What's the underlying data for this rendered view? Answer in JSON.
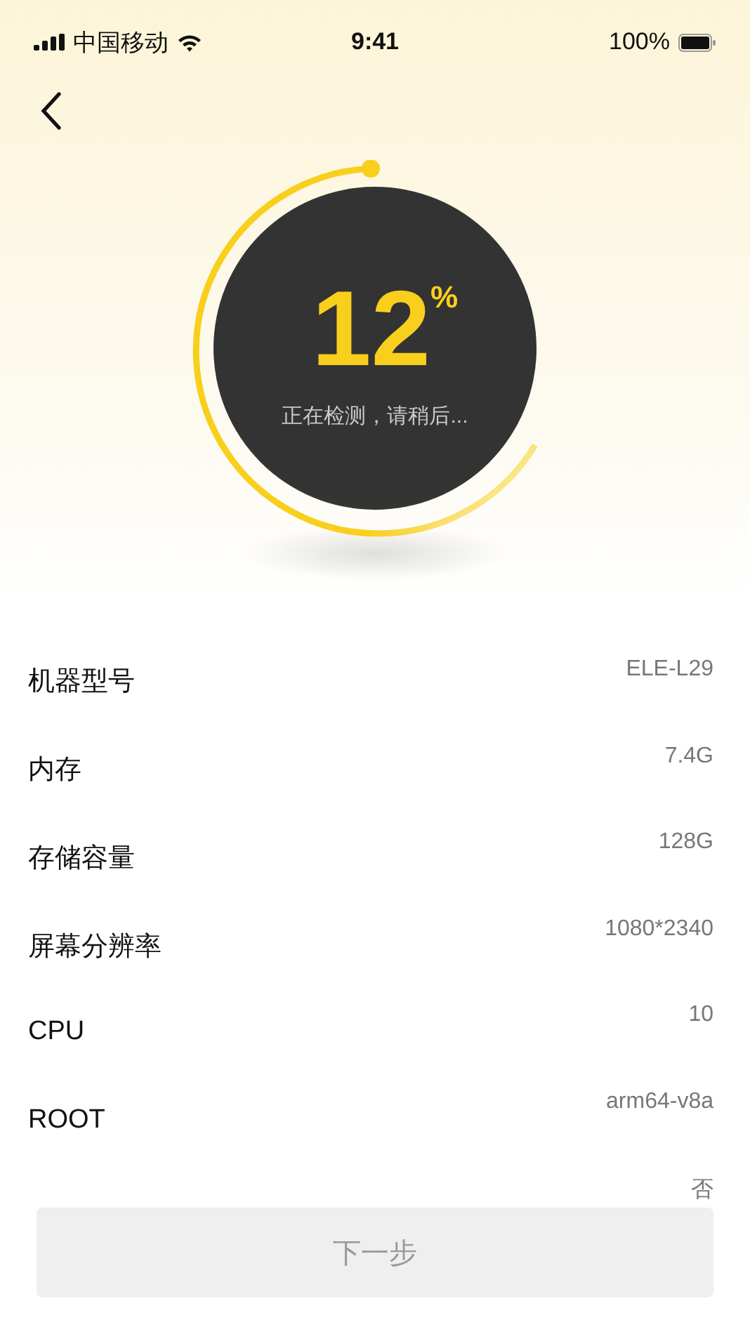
{
  "status_bar": {
    "carrier": "中国移动",
    "time": "9:41",
    "battery": "100%"
  },
  "progress": {
    "value": "12",
    "unit": "%",
    "message": "正在检测，请稍后..."
  },
  "specs": [
    {
      "label": "机器型号",
      "value": "ELE-L29"
    },
    {
      "label": "内存",
      "value": "7.4G"
    },
    {
      "label": "存储容量",
      "value": "128G"
    },
    {
      "label": "屏幕分辨率",
      "value": "1080*2340"
    },
    {
      "label": "CPU",
      "value": "10"
    },
    {
      "label": "ROOT",
      "value": "arm64-v8a"
    },
    {
      "value": "否"
    }
  ],
  "next_button": {
    "label": "下一步",
    "disabled": true
  }
}
